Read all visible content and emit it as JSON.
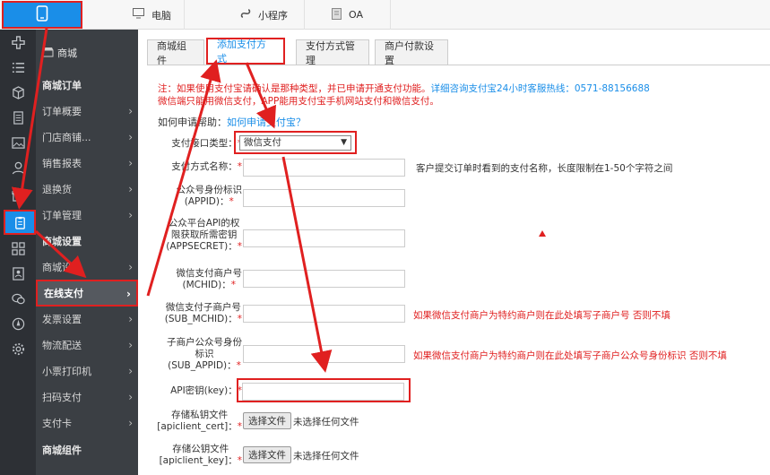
{
  "topbar": {
    "mobile_icon": "mobile-phone-icon",
    "tabs": [
      {
        "icon": "monitor-icon",
        "label": "电脑"
      },
      {
        "icon": "mini-program-icon",
        "label": "小程序"
      },
      {
        "icon": "document-icon",
        "label": "OA"
      }
    ]
  },
  "iconbar": {
    "icons": [
      "plus-cross-icon",
      "list-icon",
      "cube-icon",
      "document-icon",
      "image-icon",
      "user-icon",
      "gift-icon",
      "clipboard-icon",
      "grid-icon",
      "contacts-icon",
      "chat-icon",
      "compass-icon",
      "gear-icon"
    ]
  },
  "sidebar": {
    "header": "商城",
    "sections": [
      {
        "title": "商城订单"
      },
      {
        "title": "商城设置"
      },
      {
        "title": "商城组件"
      }
    ],
    "items": [
      {
        "label": "订单概要"
      },
      {
        "label": "门店商铺..."
      },
      {
        "label": "销售报表"
      },
      {
        "label": "退换货"
      },
      {
        "label": "订单管理"
      },
      {
        "label": "商城设置"
      },
      {
        "label": "在线支付"
      },
      {
        "label": "发票设置"
      },
      {
        "label": "物流配送"
      },
      {
        "label": "小票打印机"
      },
      {
        "label": "扫码支付"
      },
      {
        "label": "支付卡"
      }
    ]
  },
  "main": {
    "tabs": [
      "商城组件",
      "添加支付方式",
      "支付方式管理",
      "商户付款设置"
    ],
    "notice1": "注：如果使用支付宝请确认是那种类型，并已申请开通支付功能。",
    "notice1_link": "详细咨询支付宝24小时客服热线：0571-88156688",
    "notice2": "微信端只能用微信支付，APP能用支付宝手机网站支付和微信支付。",
    "help_label": "如何申请帮助：",
    "help_link": "如何申请支付宝？",
    "required_mark": "*",
    "fields": {
      "type": {
        "label": "支付接口类型：",
        "value": "微信支付"
      },
      "name": {
        "label": "支付方式名称：",
        "hint": "客户提交订单时看到的支付名称，长度限制在1-50个字符之间"
      },
      "appid": {
        "label": "公众号身份标识\n(APPID)："
      },
      "appsecret": {
        "label": "公众平台API的权\n限获取所需密钥\n(APPSECRET)："
      },
      "mchid": {
        "label": "微信支付商户号\n(MCHID)："
      },
      "sub_mchid": {
        "label": "微信支付子商户号\n(SUB_MCHID)：",
        "hint": "如果微信支付商户为特约商户则在此处填写子商户号 否则不填"
      },
      "sub_appid": {
        "label": "子商户公众号身份\n标识\n(SUB_APPID)：",
        "hint": "如果微信支付商户为特约商户则在此处填写子商户公众号身份标识 否则不填"
      },
      "apikey": {
        "label": "API密钥(key)："
      },
      "cert": {
        "label": "存储私钥文件\n[apiclient_cert]：",
        "button": "选择文件",
        "status": "未选择任何文件"
      },
      "keyfile": {
        "label": "存储公钥文件\n[apiclient_key]：",
        "button": "选择文件",
        "status": "未选择任何文件"
      }
    }
  },
  "colors": {
    "accent": "#1a8ee8",
    "annotation": "#e02020",
    "sidebar": "#3b3f44",
    "iconbar": "#2d3035"
  }
}
